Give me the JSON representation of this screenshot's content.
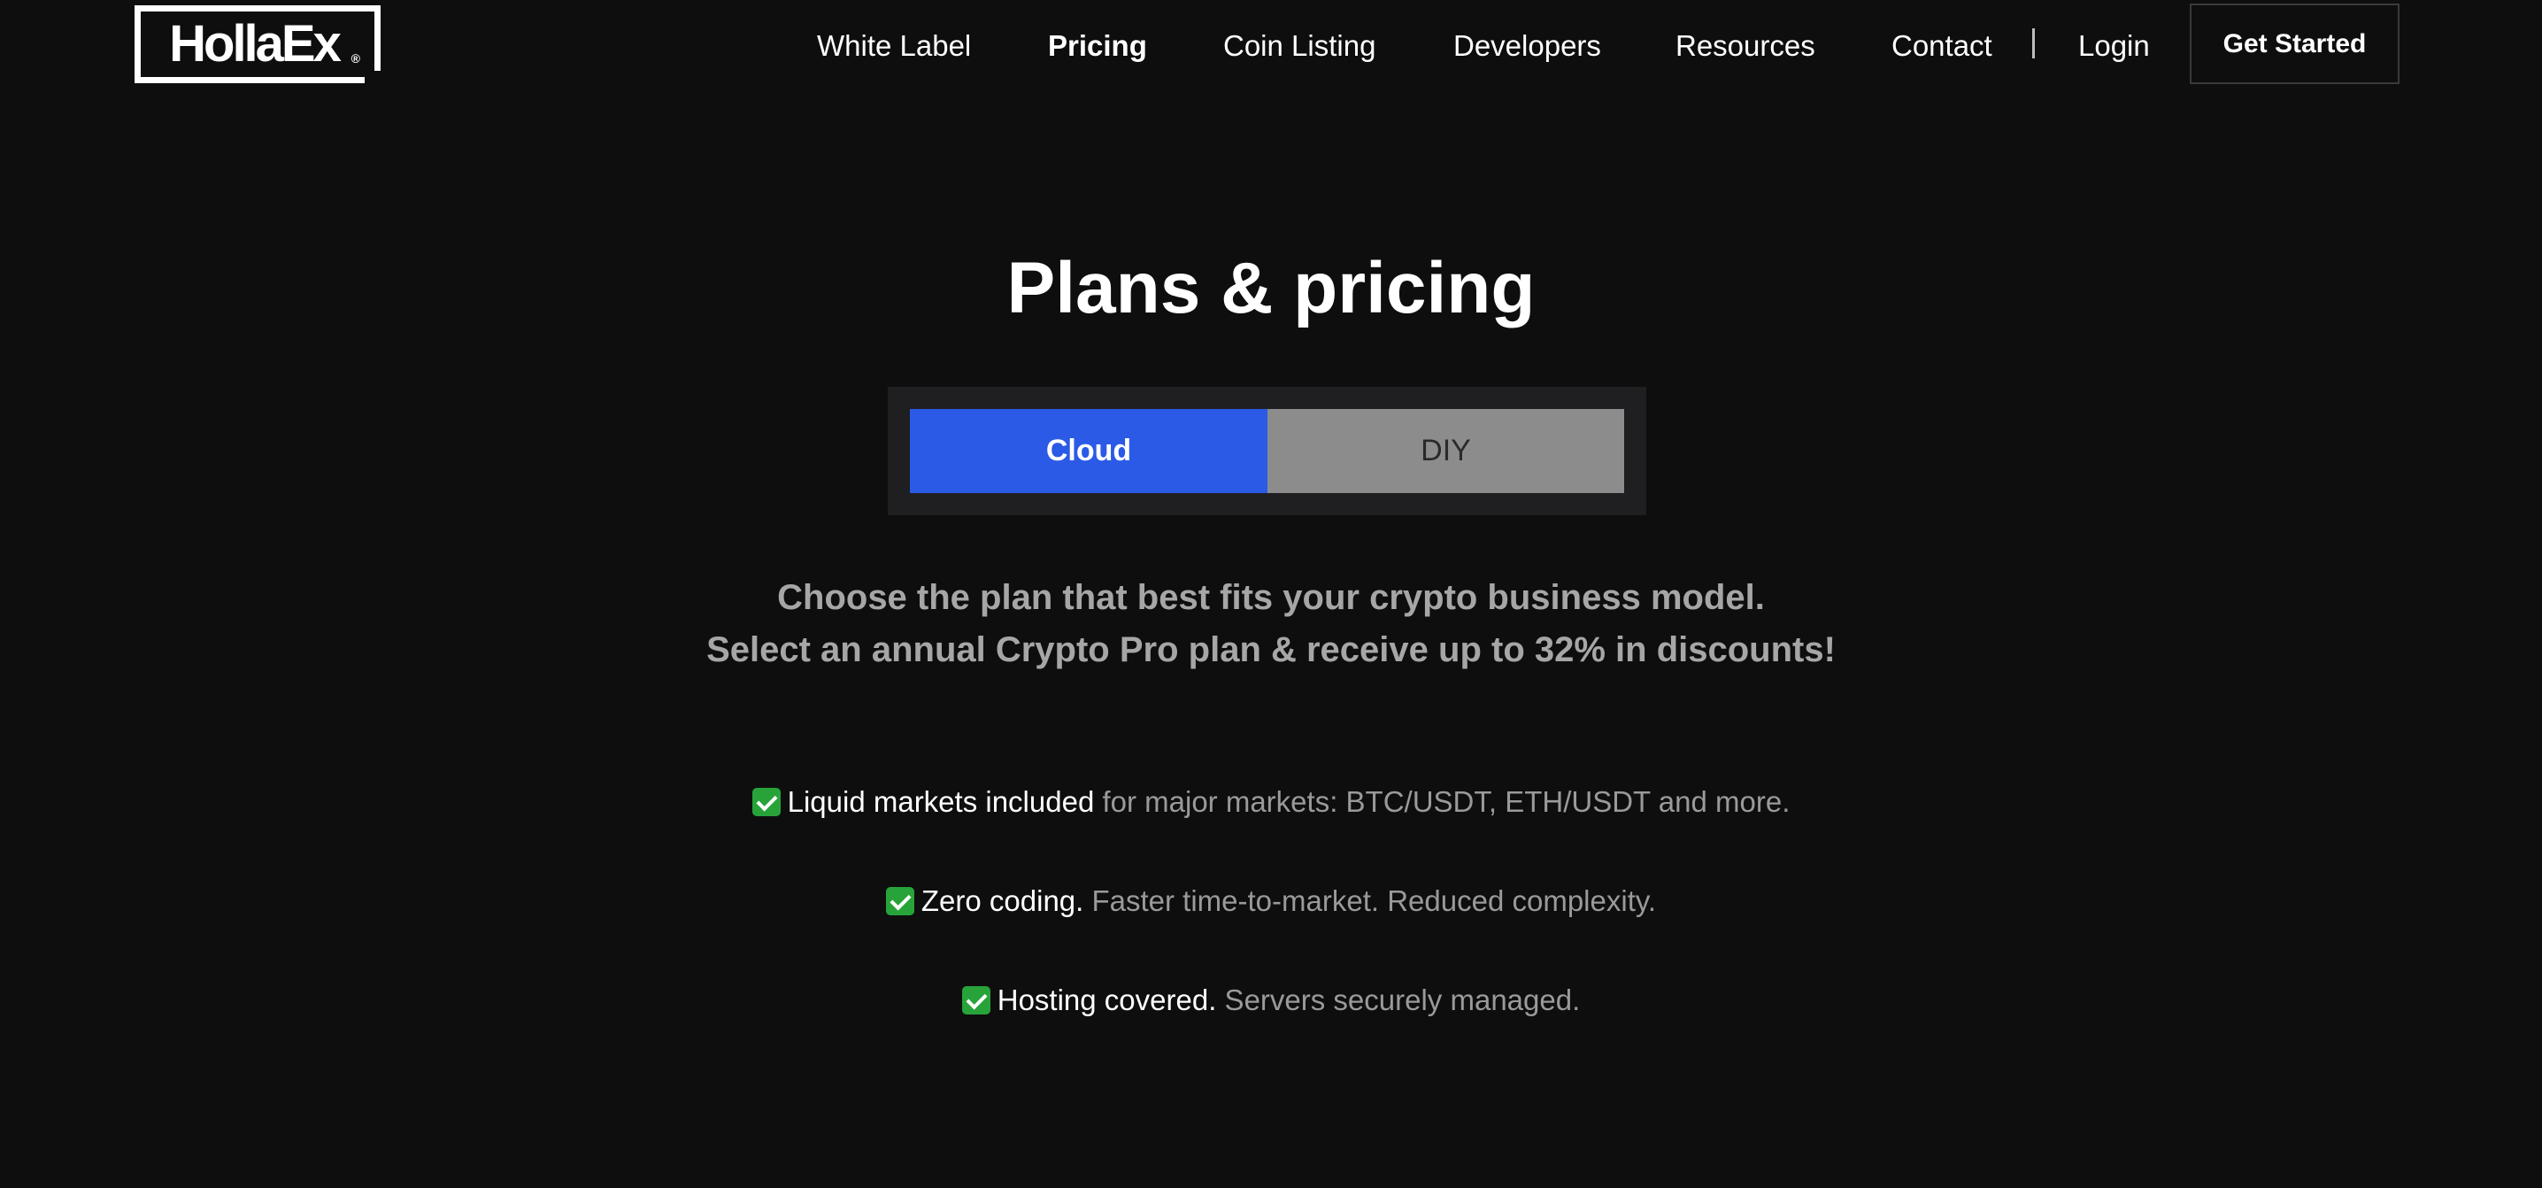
{
  "logo": {
    "text": "HollaEx",
    "mark": "®"
  },
  "nav": {
    "links": [
      {
        "label": "White Label"
      },
      {
        "label": "Pricing",
        "active": true
      },
      {
        "label": "Coin Listing"
      },
      {
        "label": "Developers"
      },
      {
        "label": "Resources"
      },
      {
        "label": "Contact"
      },
      {
        "label": "Login"
      }
    ],
    "cta_label": "Get Started"
  },
  "hero": {
    "title": "Plans & pricing",
    "toggle": {
      "options": [
        {
          "label": "Cloud",
          "selected": true
        },
        {
          "label": "DIY",
          "selected": false
        }
      ]
    },
    "subtitle_line1": "Choose the plan that best fits your crypto business model.",
    "subtitle_line2": "Select an annual Crypto Pro plan & receive up to 32% in discounts!"
  },
  "features": [
    {
      "icon": "check-mark-icon",
      "strong": "Liquid markets included",
      "rest": " for major markets: BTC/USDT, ETH/USDT and more."
    },
    {
      "icon": "check-mark-icon",
      "strong": "Zero coding.",
      "rest": " Faster time-to-market. Reduced complexity."
    },
    {
      "icon": "check-mark-icon",
      "strong": "Hosting covered.",
      "rest": " Servers securely managed."
    }
  ],
  "colors": {
    "background": "#0e0e0e",
    "accent": "#2b5ae6",
    "toggle_inactive": "#8c8c8c",
    "muted_text": "#a6a6a6",
    "check_green": "#27a33a"
  }
}
